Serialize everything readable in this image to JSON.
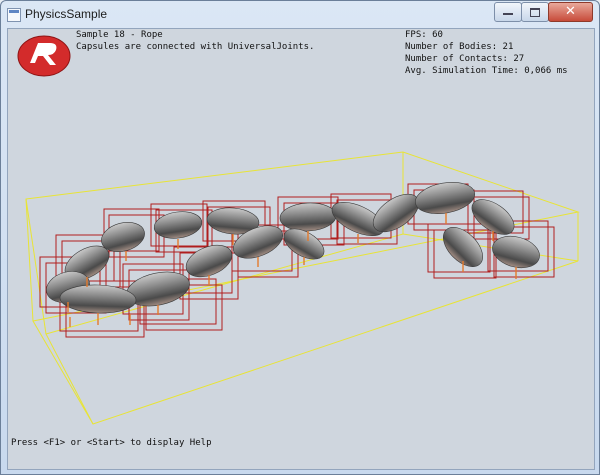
{
  "window": {
    "title": "PhysicsSample"
  },
  "caption_buttons": {
    "minimize": "minimize-icon",
    "maximize": "maximize-icon",
    "close": "close-icon"
  },
  "logo": {
    "icon": "logo-icon"
  },
  "sample": {
    "title": "Sample 18 - Rope",
    "description": "Capsules are connected with UniversalJoints."
  },
  "stats": {
    "fps": "FPS: 60",
    "bodies": "Number of Bodies: 21",
    "contacts": "Number of Contacts: 27",
    "sim_time": "Avg. Simulation Time: 0,066 ms"
  },
  "help": "Press <F1> or <Start> to display Help",
  "colors": {
    "viewport_bg": "#cfd6de",
    "bounding_box": "#e8e436",
    "aabb": "#b01e1e",
    "capsule": "#6a6a6a",
    "logo": "#d32b2b"
  }
}
